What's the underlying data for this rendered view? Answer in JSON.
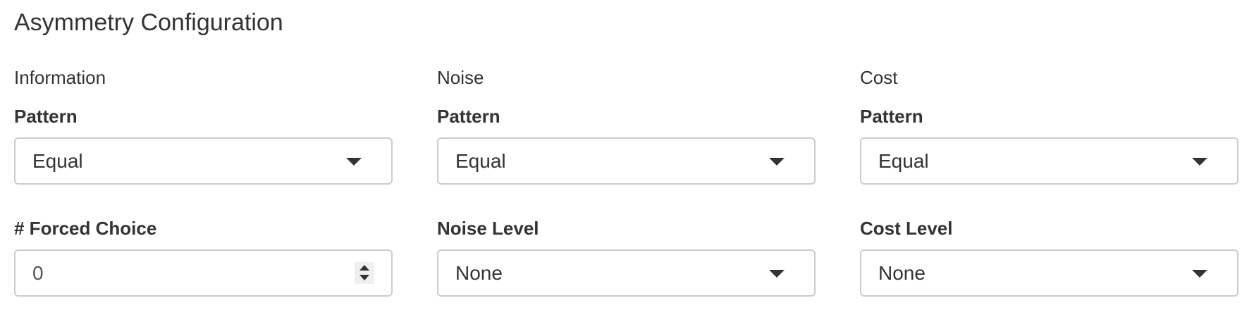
{
  "section": {
    "title": "Asymmetry Configuration"
  },
  "columns": [
    {
      "heading": "Information",
      "pattern": {
        "label": "Pattern",
        "value": "Equal",
        "icon": "chevron-down-icon"
      },
      "second": {
        "label": "# Forced Choice",
        "value": "0",
        "icon": "spinner-icon"
      }
    },
    {
      "heading": "Noise",
      "pattern": {
        "label": "Pattern",
        "value": "Equal",
        "icon": "chevron-down-icon"
      },
      "second": {
        "label": "Noise Level",
        "value": "None",
        "icon": "chevron-down-icon"
      }
    },
    {
      "heading": "Cost",
      "pattern": {
        "label": "Pattern",
        "value": "Equal",
        "icon": "chevron-down-icon"
      },
      "second": {
        "label": "Cost Level",
        "value": "None",
        "icon": "chevron-down-icon"
      }
    }
  ],
  "colors": {
    "text": "#333333",
    "border": "#cccccc",
    "spinner_bg": "#efefef"
  }
}
